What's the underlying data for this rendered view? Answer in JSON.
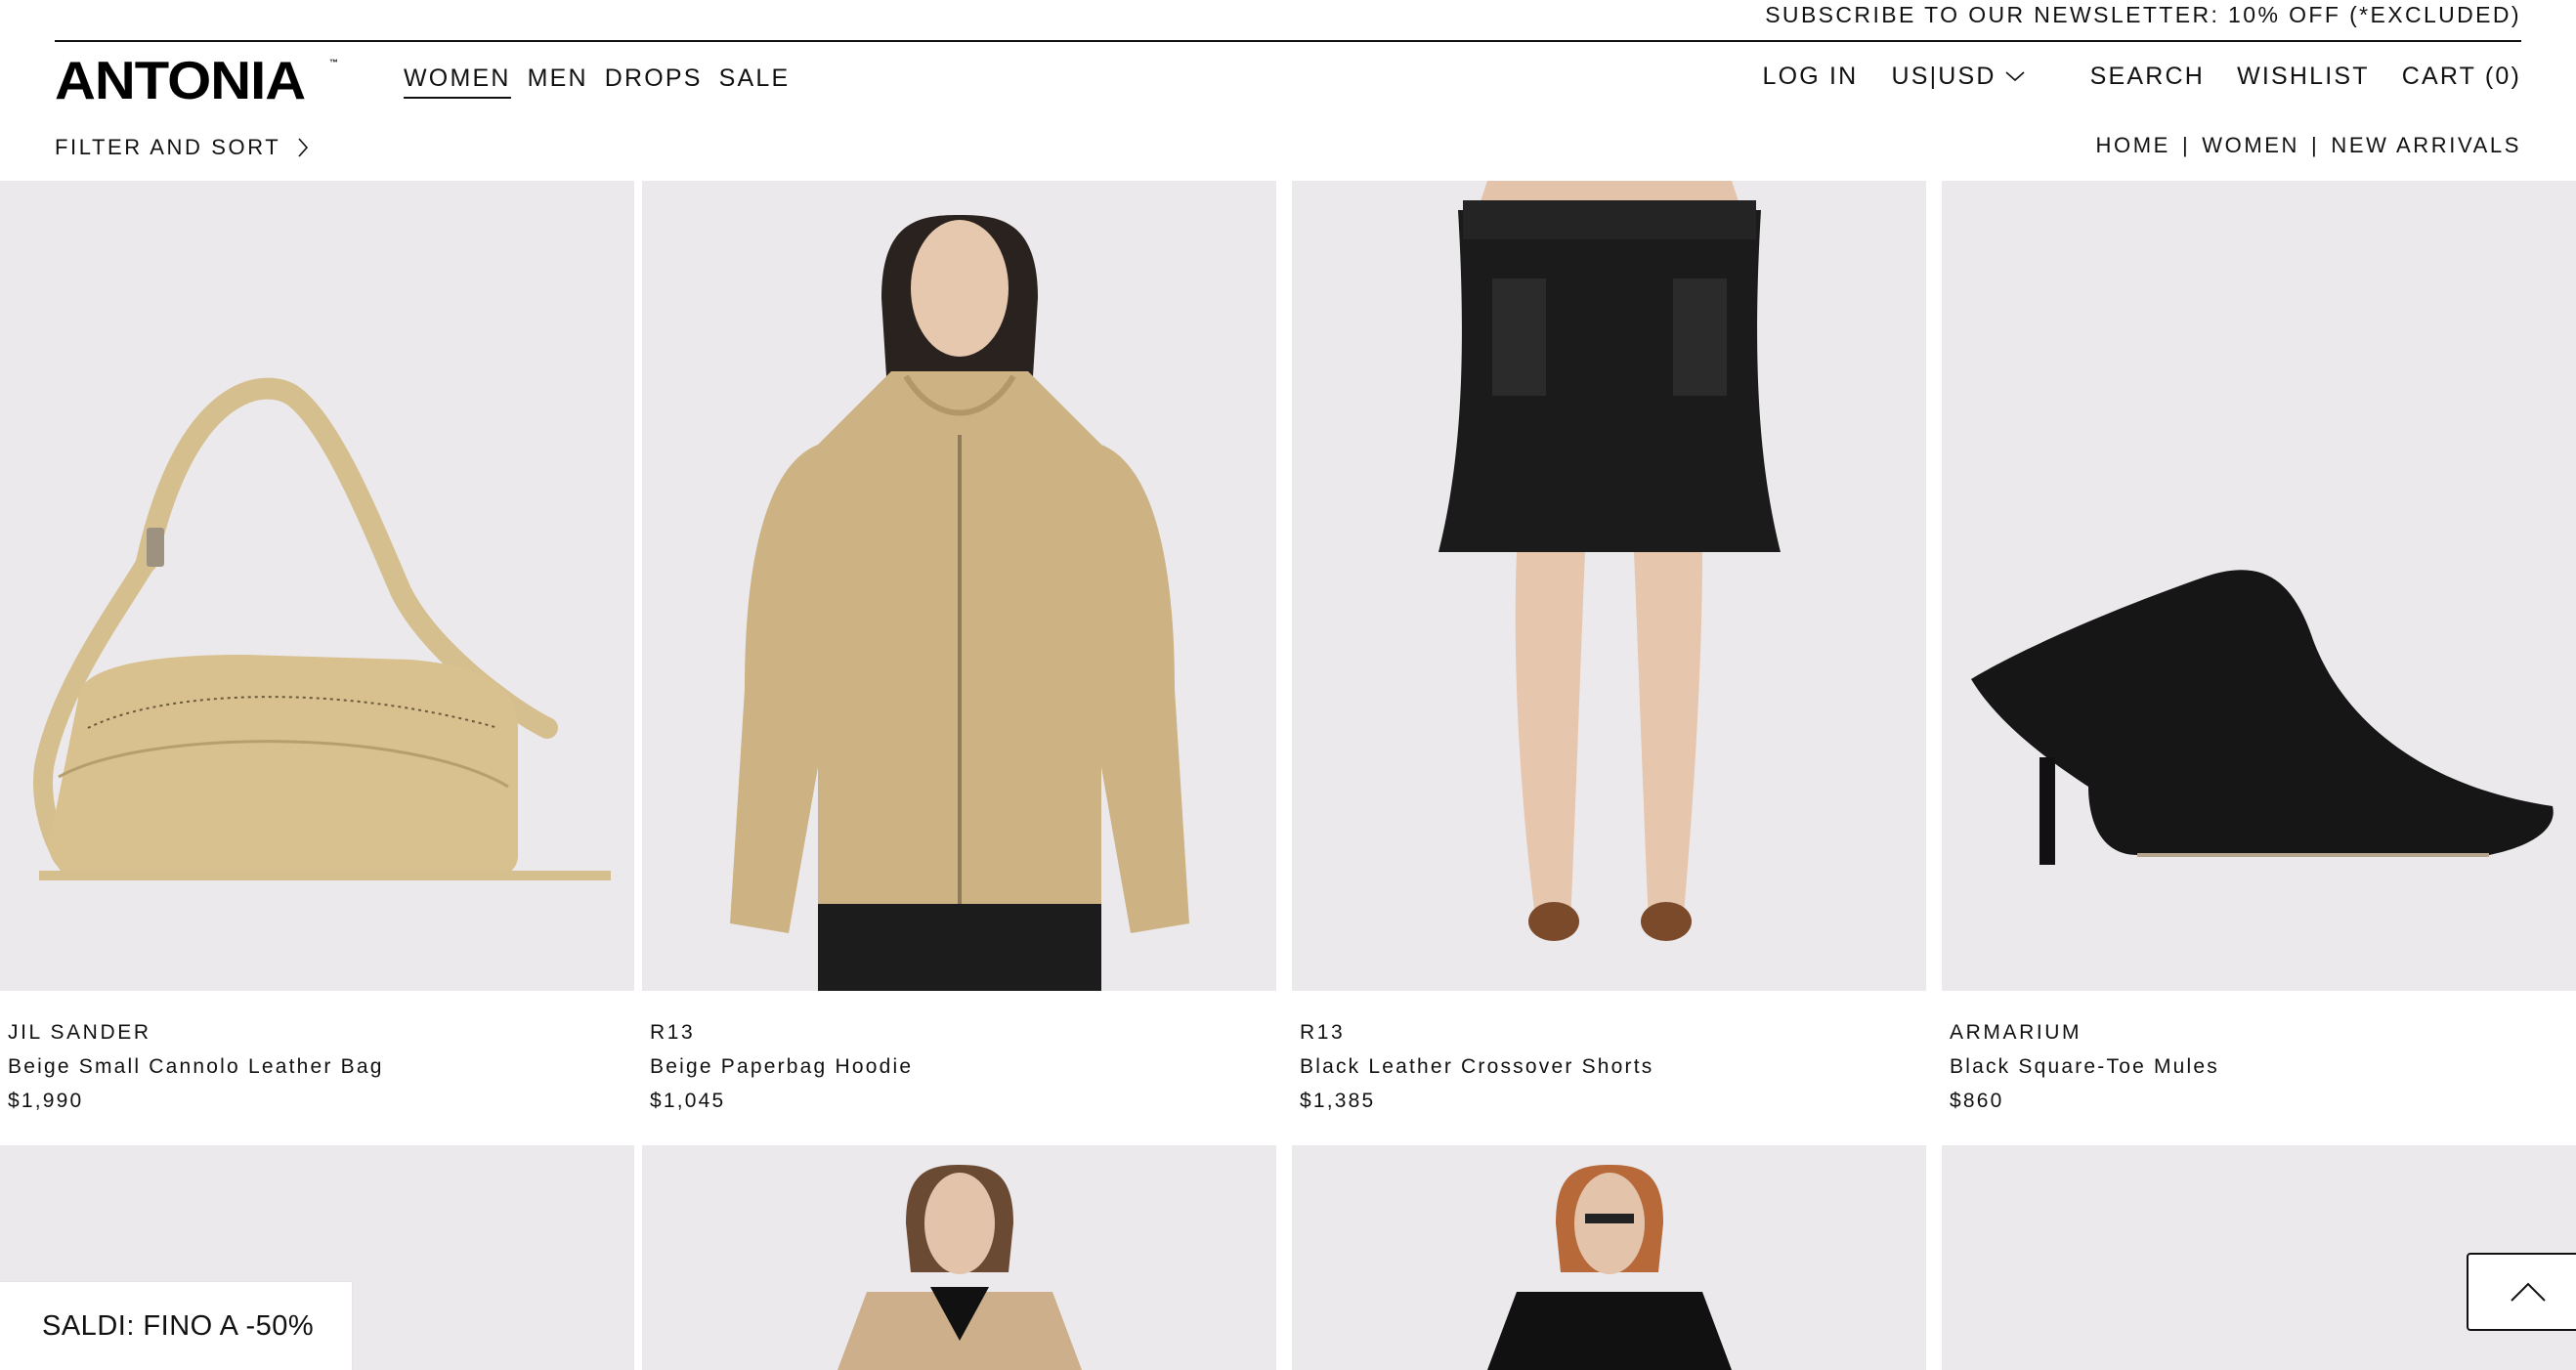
{
  "promo": {
    "text": "SUBSCRIBE TO OUR NEWSLETTER: 10% OFF (*EXCLUDED)"
  },
  "brand": {
    "logo": "ANTONIA",
    "tm": "™"
  },
  "nav": {
    "main": [
      {
        "label": "WOMEN",
        "active": true
      },
      {
        "label": "MEN"
      },
      {
        "label": "DROPS"
      },
      {
        "label": "SALE"
      }
    ],
    "login": "LOG IN",
    "currency": "US|USD",
    "search": "SEARCH",
    "wishlist": "WISHLIST",
    "cart": "CART (0)"
  },
  "toolbar": {
    "filter_label": "FILTER AND SORT",
    "breadcrumb": [
      "HOME",
      "WOMEN",
      "NEW ARRIVALS"
    ],
    "separator": "|"
  },
  "products": [
    {
      "brand": "JIL SANDER",
      "name": "Beige Small Cannolo Leather Bag",
      "price": "$1,990"
    },
    {
      "brand": "R13",
      "name": "Beige Paperbag Hoodie",
      "price": "$1,045"
    },
    {
      "brand": "R13",
      "name": "Black Leather Crossover Shorts",
      "price": "$1,385"
    },
    {
      "brand": "ARMARIUM",
      "name": "Black Square-Toe Mules",
      "price": "$860"
    }
  ],
  "saldi_banner": "SALDI: FINO A -50%",
  "colors": {
    "text": "#111111",
    "image_bg": "#ebe9ec",
    "beige": "#d8c08f",
    "black_leather": "#1a1a1a"
  },
  "icons": {
    "currency_dropdown": "chevron-down-icon",
    "filter": "chevron-right-icon",
    "scroll_top": "chevron-up-icon"
  }
}
